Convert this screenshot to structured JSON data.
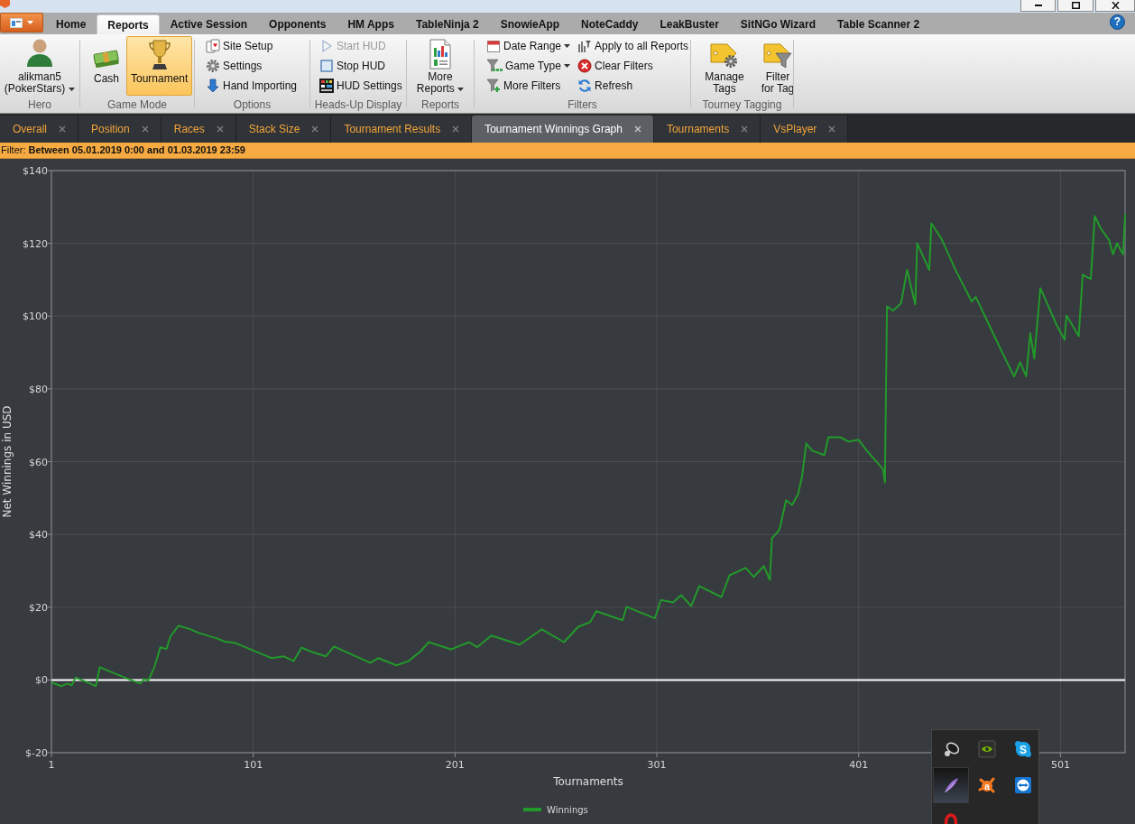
{
  "menu_tabs": [
    {
      "label": "Home",
      "selected": false
    },
    {
      "label": "Reports",
      "selected": true
    },
    {
      "label": "Active Session",
      "selected": false
    },
    {
      "label": "Opponents",
      "selected": false
    },
    {
      "label": "HM Apps",
      "selected": false
    },
    {
      "label": "TableNinja 2",
      "selected": false
    },
    {
      "label": "SnowieApp",
      "selected": false
    },
    {
      "label": "NoteCaddy",
      "selected": false
    },
    {
      "label": "LeakBuster",
      "selected": false
    },
    {
      "label": "SitNGo Wizard",
      "selected": false
    },
    {
      "label": "Table Scanner 2",
      "selected": false
    }
  ],
  "help_button": {
    "label": "?"
  },
  "ribbon": {
    "groups": [
      {
        "kind": "hero",
        "label": "Hero",
        "user": "alikman5",
        "site": "(PokerStars)",
        "dropdown": true
      },
      {
        "kind": "large",
        "label": "Game Mode",
        "buttons": [
          {
            "label": "Cash",
            "selected": false
          },
          {
            "label": "Tournament",
            "selected": true
          }
        ]
      },
      {
        "kind": "small",
        "label": "Options",
        "columns": [
          [
            {
              "label": "Site Setup"
            },
            {
              "label": "Settings"
            },
            {
              "label": "Hand Importing"
            }
          ]
        ]
      },
      {
        "kind": "small",
        "label": "Heads-Up Display",
        "columns": [
          [
            {
              "label": "Start HUD",
              "disabled": true
            },
            {
              "label": "Stop HUD",
              "disabled": false
            },
            {
              "label": "HUD Settings",
              "disabled": false
            }
          ]
        ]
      },
      {
        "kind": "large",
        "label": "Reports",
        "buttons": [
          {
            "label": "More Reports",
            "dropdown": true
          }
        ]
      },
      {
        "kind": "small",
        "label": "Filters",
        "columns": [
          [
            {
              "label": "Date Range",
              "dropdown": true
            },
            {
              "label": "Game Type",
              "dropdown": true
            },
            {
              "label": "More Filters",
              "dropdown": false
            }
          ],
          [
            {
              "label": "Apply to all Reports",
              "dropdown": false
            },
            {
              "label": "Clear Filters",
              "dropdown": false
            },
            {
              "label": "Refresh",
              "dropdown": false
            }
          ]
        ]
      },
      {
        "kind": "large",
        "label": "Tourney Tagging",
        "buttons": [
          {
            "label": "Manage Tags"
          },
          {
            "label": "Filter for Tag"
          }
        ]
      }
    ]
  },
  "report_tabs": [
    {
      "label": "Overall",
      "selected": false
    },
    {
      "label": "Position",
      "selected": false
    },
    {
      "label": "Races",
      "selected": false
    },
    {
      "label": "Stack Size",
      "selected": false
    },
    {
      "label": "Tournament Results",
      "selected": false
    },
    {
      "label": "Tournament Winnings Graph",
      "selected": true
    },
    {
      "label": "Tournaments",
      "selected": false
    },
    {
      "label": "VsPlayer",
      "selected": false
    }
  ],
  "filter_bar": {
    "text": "Filter: **Between 05.01.2019 0:00 and 01.03.2019 23:59**"
  },
  "chart": {
    "chart_data": {
      "type": "line",
      "xlabel": "Tournaments",
      "ylabel": "Net Winnings in USD",
      "grid": true,
      "xlim": [
        1,
        533
      ],
      "ylim": [
        -20,
        140
      ],
      "xticks": [
        1,
        101,
        201,
        301,
        401,
        501
      ],
      "yticks": [
        {
          "value": -20,
          "label": "$-20"
        },
        {
          "value": 0,
          "label": "$0"
        },
        {
          "value": 20,
          "label": "$20"
        },
        {
          "value": 40,
          "label": "$40"
        },
        {
          "value": 60,
          "label": "$60"
        },
        {
          "value": 80,
          "label": "$80"
        },
        {
          "value": 100,
          "label": "$100"
        },
        {
          "value": 120,
          "label": "$120"
        },
        {
          "value": 140,
          "label": "$140"
        }
      ],
      "ref_lines": [
        {
          "axis": "y",
          "value": 0
        }
      ],
      "x": [
        1,
        6,
        9,
        11,
        13,
        18,
        23,
        25,
        38,
        45,
        47,
        49,
        52,
        55,
        58,
        60,
        64,
        70,
        74,
        83,
        87,
        92,
        110,
        116,
        121,
        125,
        130,
        137,
        141,
        159,
        163,
        172,
        178,
        184,
        188,
        199,
        208,
        212,
        219,
        233,
        244,
        255,
        262,
        268,
        271,
        284,
        286,
        300,
        303,
        309,
        313,
        318,
        322,
        333,
        337,
        340,
        345,
        349,
        354,
        357,
        358,
        361,
        362,
        365,
        368,
        371,
        373,
        375,
        378,
        384,
        386,
        392,
        396,
        401,
        405,
        413,
        414,
        415,
        418,
        422,
        425,
        429,
        430,
        436,
        437,
        442,
        449,
        457,
        459,
        468,
        473,
        478,
        481,
        484,
        486,
        488,
        491,
        495,
        499,
        503,
        504,
        510,
        512,
        516,
        518,
        521,
        525,
        527,
        529,
        531,
        532,
        533
      ],
      "series": [
        {
          "name": "Winnings",
          "color": "#22992b",
          "values": [
            -0.7,
            -1.7,
            -1,
            -1.5,
            0.7,
            -0.5,
            -1.7,
            3.5,
            0.5,
            -1,
            0.3,
            -0.2,
            3.5,
            9,
            8.5,
            12,
            14.9,
            13.9,
            12.9,
            11.4,
            10.5,
            10.2,
            6,
            6.5,
            5.2,
            8.9,
            7.7,
            6.5,
            9.2,
            4.7,
            6,
            4,
            5.2,
            7.9,
            10.4,
            8.4,
            10.4,
            9,
            12.2,
            9.7,
            13.9,
            10.4,
            14.6,
            15.9,
            18.9,
            16.4,
            20.1,
            16.9,
            22,
            21.3,
            23.3,
            20.3,
            25.8,
            22.8,
            28.8,
            29.5,
            30.8,
            28.3,
            31.3,
            27.5,
            39,
            40.7,
            41.9,
            49.4,
            48.1,
            51.1,
            56.1,
            65,
            63,
            61.8,
            66.7,
            66.7,
            65.5,
            66,
            63,
            58,
            54.3,
            102.7,
            101.5,
            103.5,
            112.7,
            103.2,
            120,
            112.7,
            125.5,
            121.3,
            112.7,
            104,
            105.3,
            94.8,
            89,
            83.4,
            87.3,
            83.4,
            95.3,
            88.3,
            107.7,
            102.7,
            97.7,
            93.5,
            100.2,
            94.5,
            111.4,
            110.2,
            127.5,
            124,
            121,
            117,
            120,
            118,
            117,
            128
          ]
        }
      ]
    }
  },
  "tray_icons": [
    {
      "selected": false
    },
    {
      "selected": false
    },
    {
      "selected": false,
      "glyph": "S"
    },
    {
      "selected": true
    },
    {
      "selected": false,
      "glyph": "a"
    },
    {
      "selected": false
    },
    {
      "selected": false
    }
  ]
}
